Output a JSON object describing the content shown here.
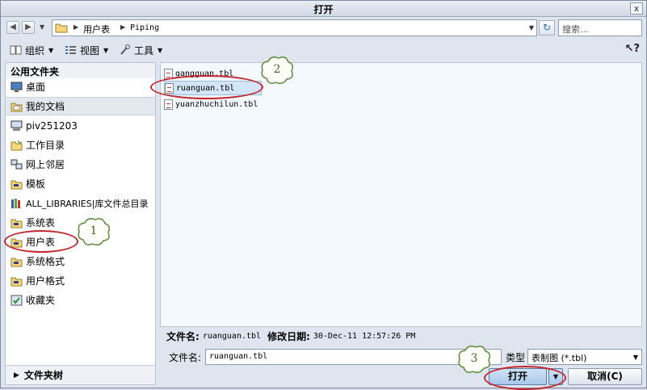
{
  "window": {
    "title": "打开",
    "close_glyph": "x"
  },
  "address": {
    "back_glyph": "◀",
    "forward_glyph": "▶",
    "crumbs": [
      "用户表",
      "Piping"
    ],
    "search_placeholder": "搜索..."
  },
  "toolbar": {
    "organize_label": "组织",
    "view_label": "视图",
    "tools_label": "工具"
  },
  "sidebar": {
    "header": "公用文件夹",
    "items": [
      {
        "label": "桌面",
        "icon": "desktop-icon"
      },
      {
        "label": "我的文档",
        "icon": "documents-folder-icon",
        "selected": true
      },
      {
        "label": "piv251203",
        "icon": "computer-icon"
      },
      {
        "label": "工作目录",
        "icon": "work-folder-icon"
      },
      {
        "label": "网上邻居",
        "icon": "network-icon"
      },
      {
        "label": "模板",
        "icon": "folder-icon"
      },
      {
        "label": "ALL_LIBRARIES|库文件总目录",
        "icon": "library-icon"
      },
      {
        "label": "系统表",
        "icon": "folder-icon"
      },
      {
        "label": "用户表",
        "icon": "folder-icon"
      },
      {
        "label": "系统格式",
        "icon": "folder-icon"
      },
      {
        "label": "用户格式",
        "icon": "folder-icon"
      },
      {
        "label": "收藏夹",
        "icon": "favorites-icon"
      }
    ],
    "tree_label": "文件夹树"
  },
  "files": [
    {
      "name": "gangguan.tbl",
      "selected": false
    },
    {
      "name": "ruanguan.tbl",
      "selected": true
    },
    {
      "name": "yuanzhuchilun.tbl",
      "selected": false
    }
  ],
  "info": {
    "filename_label": "文件名:",
    "filename_value": "ruanguan.tbl",
    "modified_label": "修改日期:",
    "modified_value": "30-Dec-11 12:57:26 PM"
  },
  "bottom": {
    "filename_label": "文件名:",
    "filename_value": "ruanguan.tbl",
    "type_label": "类型",
    "type_value": "表制图 (*.tbl)",
    "open_label": "打开",
    "cancel_label": "取消(C)"
  },
  "annotations": [
    "1",
    "2",
    "3"
  ],
  "colors": {
    "annotation_ring": "#c0272d",
    "selection": "#d3e4f7",
    "cloud_outline": "#5a8a3a"
  }
}
